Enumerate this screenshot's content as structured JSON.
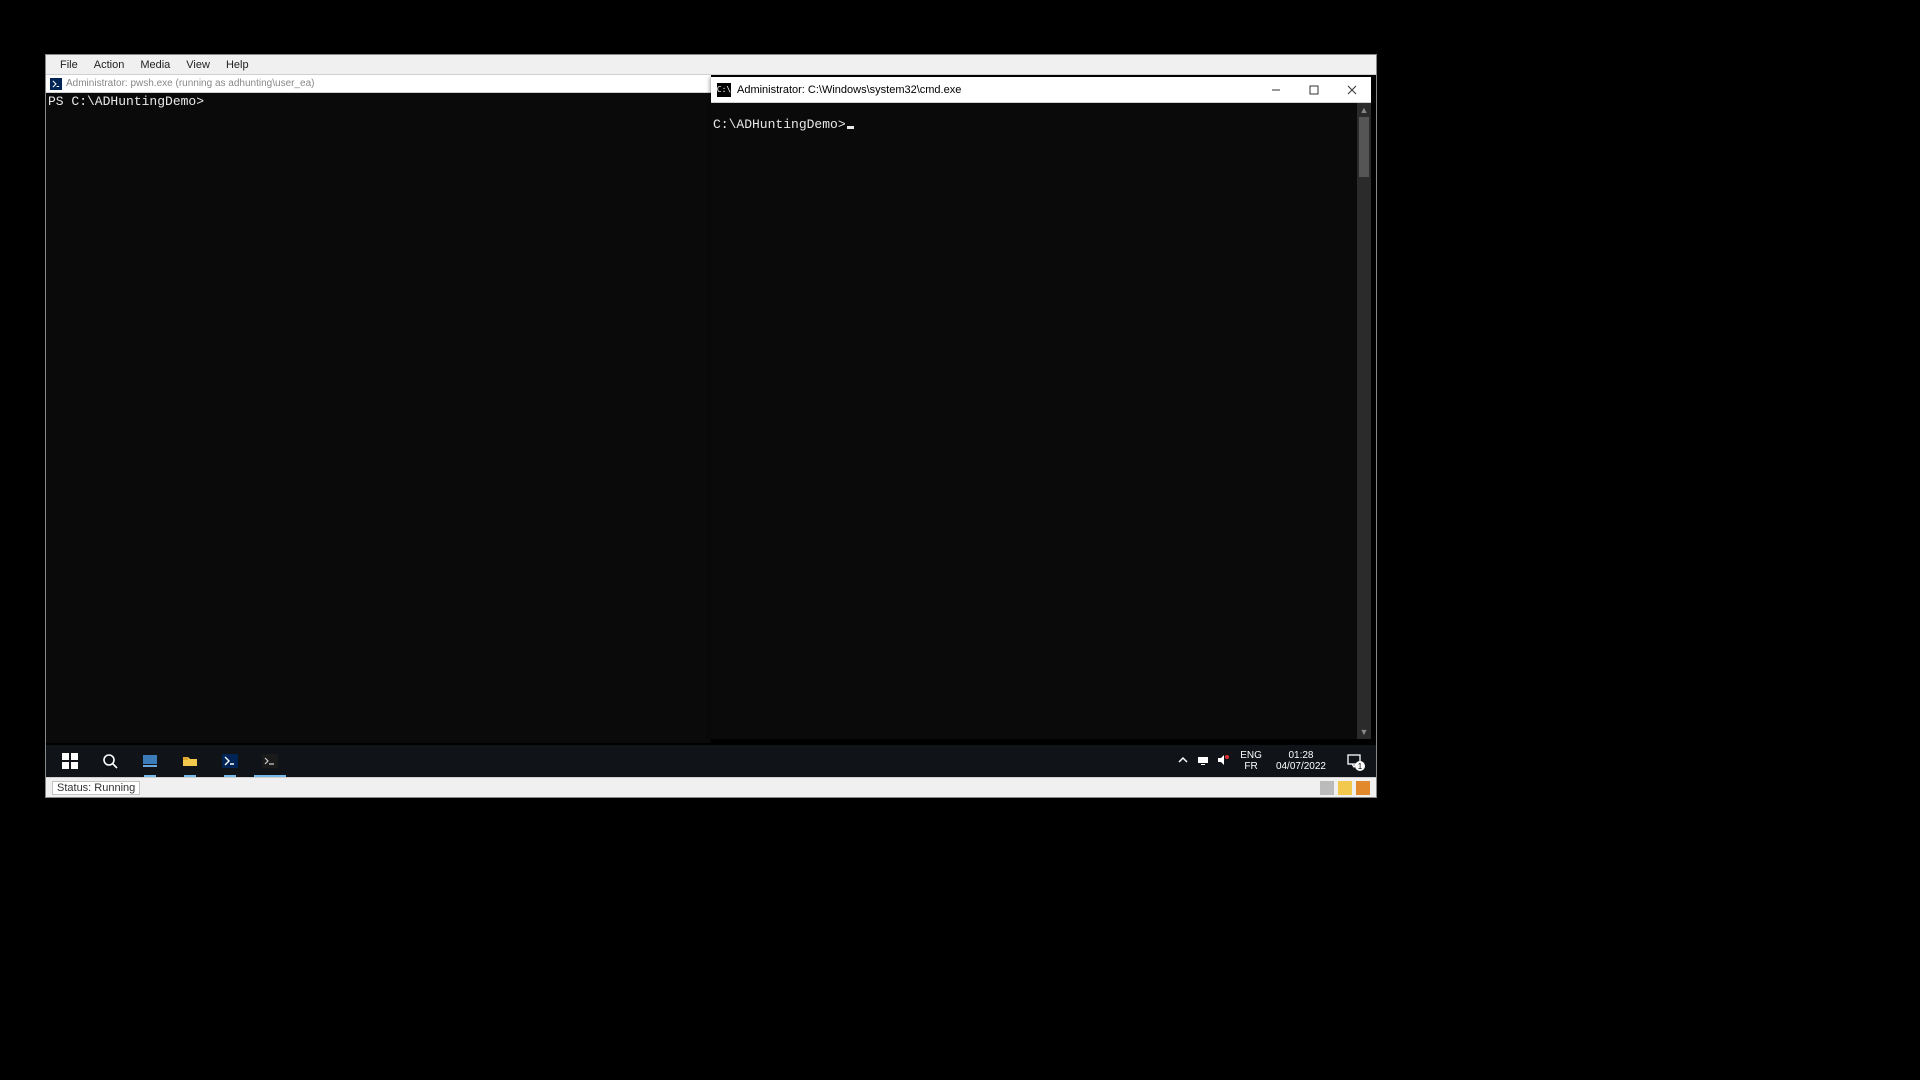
{
  "vm": {
    "menu": {
      "file": "File",
      "action": "Action",
      "media": "Media",
      "view": "View",
      "help": "Help"
    },
    "status_label": "Status: Running"
  },
  "ps_window": {
    "title": "Administrator: pwsh.exe (running as adhunting\\user_ea)",
    "prompt": "PS C:\\ADHuntingDemo>"
  },
  "cmd_window": {
    "title": "Administrator: C:\\Windows\\system32\\cmd.exe",
    "prompt": "C:\\ADHuntingDemo>"
  },
  "taskbar": {
    "lang_primary": "ENG",
    "lang_secondary": "FR",
    "time": "01:28",
    "date": "04/07/2022",
    "notif_count": "1"
  }
}
